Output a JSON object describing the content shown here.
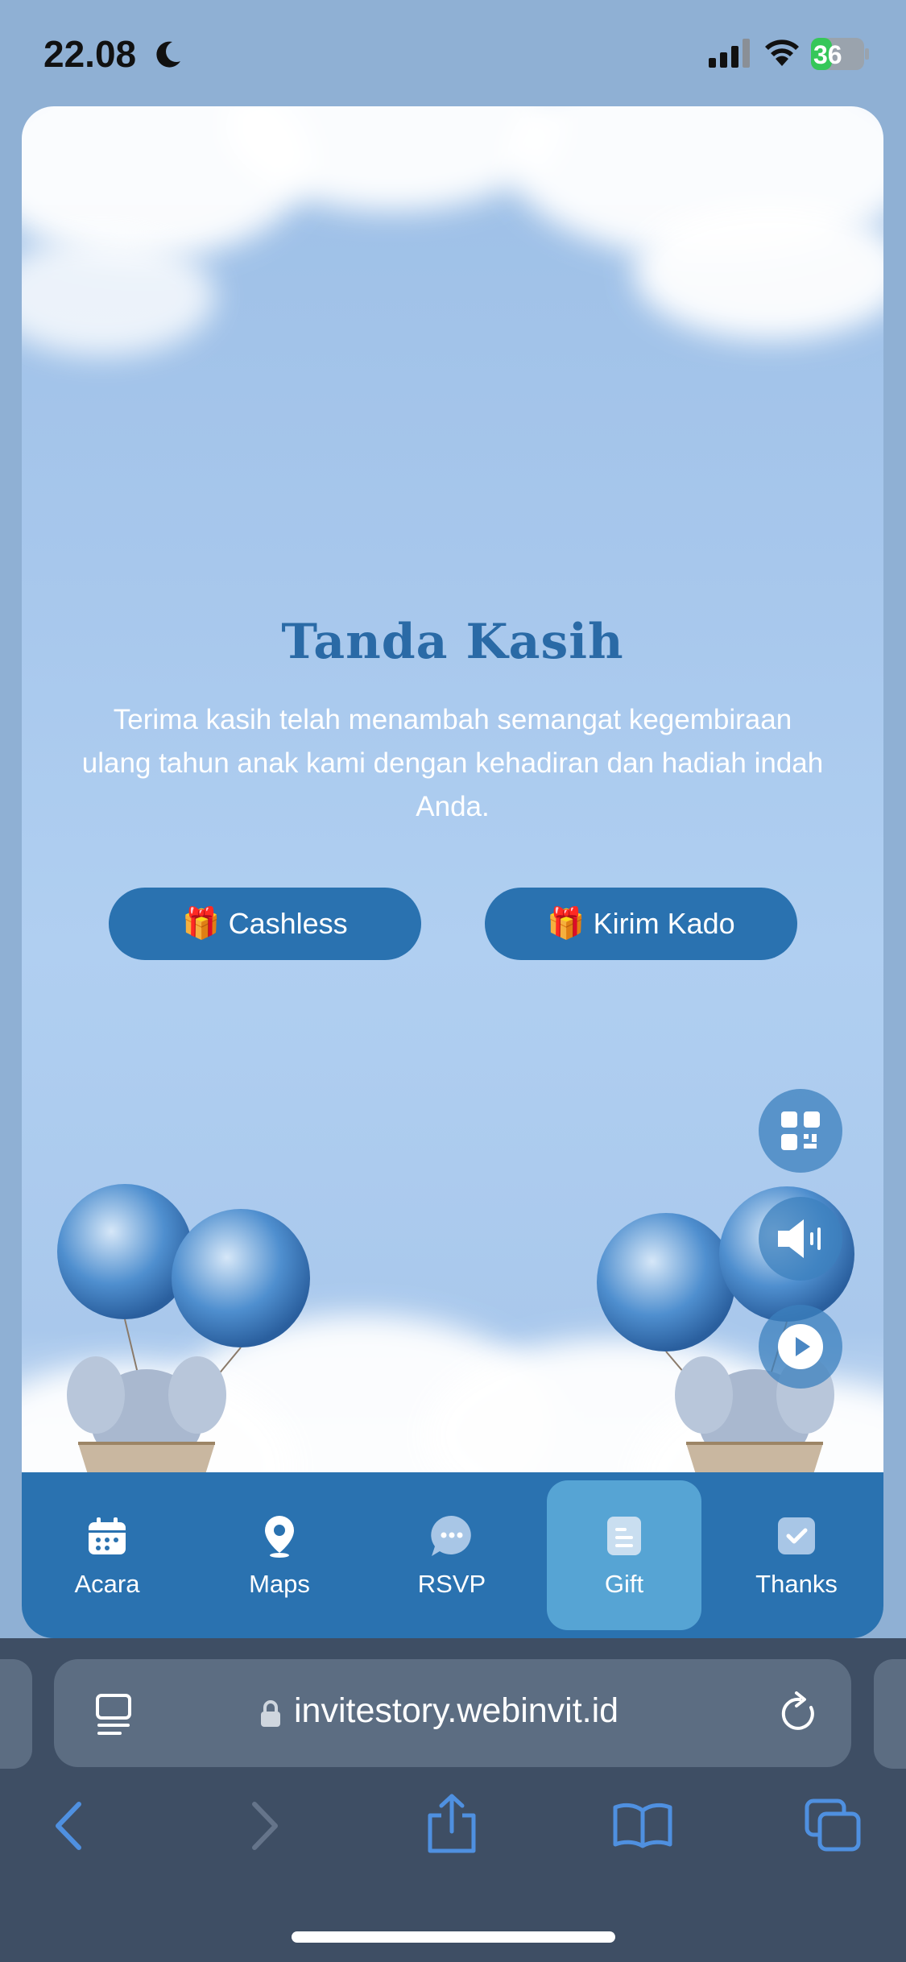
{
  "status_bar": {
    "time": "22.08",
    "battery": "36"
  },
  "section": {
    "title": "Tanda Kasih",
    "message": "Terima kasih telah menambah semangat kegembiraan ulang tahun anak kami dengan kehadiran dan hadiah indah Anda."
  },
  "buttons": {
    "cashless_icon": "🎁",
    "cashless": "Cashless",
    "kado_icon": "🎁",
    "kado": "Kirim Kado"
  },
  "floating_buttons": [
    "qr-code-icon",
    "speaker-icon",
    "play-icon"
  ],
  "bottom_nav": {
    "items": [
      {
        "label": "Acara",
        "icon": "calendar-icon"
      },
      {
        "label": "Maps",
        "icon": "map-pin-icon"
      },
      {
        "label": "RSVP",
        "icon": "chat-icon"
      },
      {
        "label": "Gift",
        "icon": "document-icon"
      },
      {
        "label": "Thanks",
        "icon": "check-icon"
      }
    ],
    "active": "Gift"
  },
  "browser": {
    "url": "invitestory.webinvit.id"
  },
  "colors": {
    "primary": "#2a72b0",
    "active_nav": "#56a4d4",
    "heading": "#2a6aa6",
    "safari_bg": "#3e4e64"
  }
}
